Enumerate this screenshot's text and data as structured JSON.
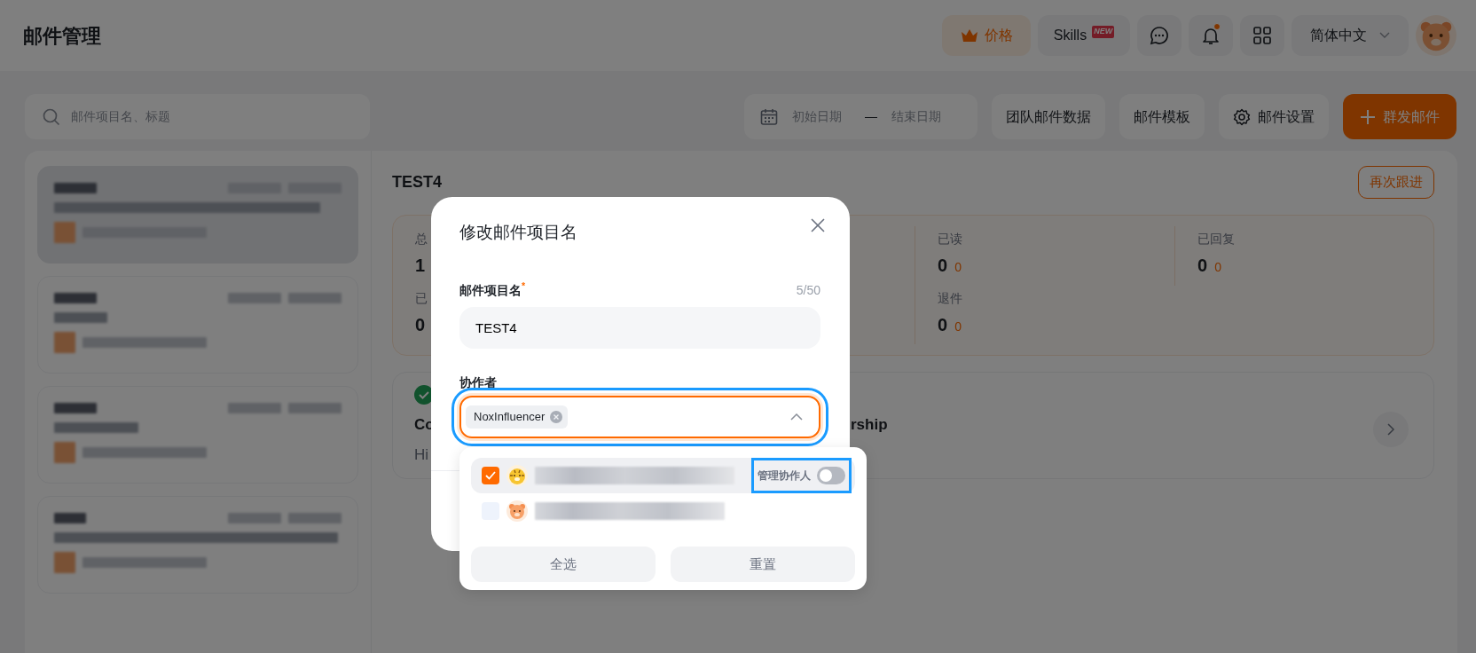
{
  "header": {
    "title": "邮件管理",
    "pricing_button": "价格",
    "skills": {
      "label": "Skills",
      "badge": "NEW"
    },
    "notification_dot": true,
    "language": "简体中文"
  },
  "toolbar": {
    "search": {
      "placeholder": "邮件项目名、标题"
    },
    "date_range": {
      "start_placeholder": "初始日期",
      "separator": "—",
      "end_placeholder": "结束日期"
    },
    "buttons": [
      {
        "kind": "plain",
        "label": "团队邮件数据"
      },
      {
        "kind": "plain",
        "label": "邮件模板"
      },
      {
        "kind": "settings",
        "label": "邮件设置"
      },
      {
        "kind": "primary",
        "label": "群发邮件"
      }
    ]
  },
  "mail_projects": [
    {
      "selected": true
    },
    {
      "selected": false
    },
    {
      "selected": false
    },
    {
      "selected": false
    }
  ],
  "detail": {
    "title": "TEST4",
    "follow_up_button": "再次跟进",
    "stats": [
      [
        {
          "label": "总",
          "value": "1"
        },
        {
          "label": "已读",
          "value": "0",
          "sub": "0"
        },
        {
          "label": "已回复",
          "value": "0",
          "sub": "0"
        }
      ],
      [
        {
          "label": "已",
          "value": "0"
        },
        {
          "label": "退件",
          "value": "0",
          "sub": "0"
        }
      ]
    ],
    "email_card": {
      "title_start": "Co",
      "title_end": "rship",
      "preview": "Hi"
    }
  },
  "modal": {
    "title": "修改邮件项目名",
    "name_field": {
      "label": "邮件项目名$^{*}$",
      "counter": "5/50",
      "value": "TEST4"
    },
    "collaborators": {
      "label": "协作者",
      "tags": [
        "NoxInfluencer"
      ],
      "expanded": true,
      "highlighted": true,
      "options": [
        {
          "kind": "tiger",
          "checked": true,
          "hovered": true,
          "manage_toggle": {
            "label": "管理协作人",
            "on": false,
            "highlighted": true
          }
        },
        {
          "kind": "bear",
          "checked": false,
          "hovered": false
        }
      ],
      "actions": [
        "全选",
        "重置"
      ]
    }
  }
}
